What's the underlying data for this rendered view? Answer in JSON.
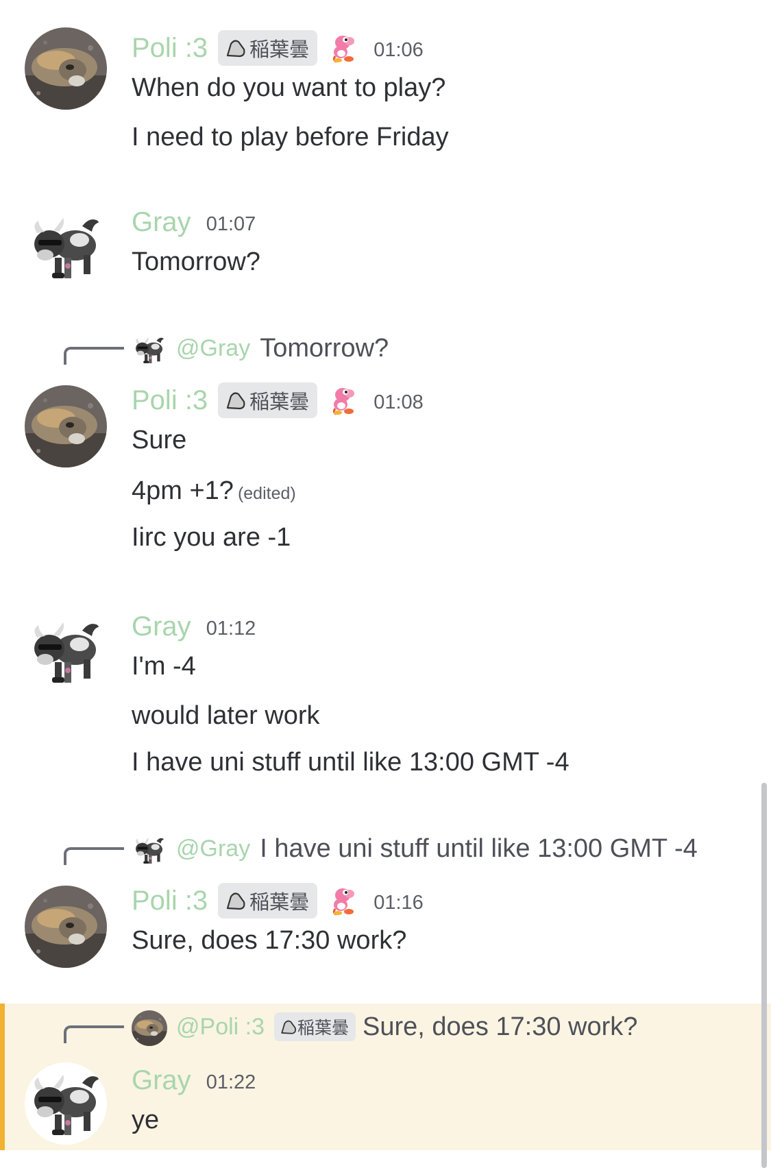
{
  "colors": {
    "username": "#a8d5ac",
    "text": "#2e3035",
    "timestamp": "#5c5e66",
    "tag_bg": "#e6e7e9",
    "highlight_bg": "#fbf4e2",
    "highlight_bar": "#f0b232",
    "reply_spine": "#6d6f78"
  },
  "messages": [
    {
      "author": "Poli :3",
      "tag": "稲葉曇",
      "tag_icon": "rock-icon",
      "role_icon": "pink-yoshi-icon",
      "time": "01:06",
      "avatar": "toad-avatar",
      "lines": [
        "When do you want to play?",
        "I need to play before Friday"
      ]
    },
    {
      "author": "Gray",
      "time": "01:07",
      "avatar": "tauros-avatar",
      "lines": [
        "Tomorrow?"
      ]
    },
    {
      "reply": {
        "mention": "@Gray",
        "text": "Tomorrow?",
        "avatar": "tauros-avatar"
      },
      "author": "Poli :3",
      "tag": "稲葉曇",
      "tag_icon": "rock-icon",
      "role_icon": "pink-yoshi-icon",
      "time": "01:08",
      "avatar": "toad-avatar",
      "lines": [
        "Sure",
        "4pm +1?",
        "Iirc you are -1"
      ],
      "edited_label": "(edited)"
    },
    {
      "author": "Gray",
      "time": "01:12",
      "avatar": "tauros-avatar",
      "lines": [
        "I'm -4",
        "would later work",
        "I have uni stuff until like 13:00 GMT -4"
      ]
    },
    {
      "reply": {
        "mention": "@Gray",
        "text": "I have uni stuff until like 13:00 GMT -4",
        "avatar": "tauros-avatar"
      },
      "author": "Poli :3",
      "tag": "稲葉曇",
      "tag_icon": "rock-icon",
      "role_icon": "pink-yoshi-icon",
      "time": "01:16",
      "avatar": "toad-avatar",
      "lines": [
        "Sure, does 17:30 work?"
      ]
    },
    {
      "highlighted": true,
      "reply": {
        "mention": "@Poli :3",
        "tag": "稲葉曇",
        "text": "Sure, does 17:30 work?",
        "avatar": "toad-avatar"
      },
      "author": "Gray",
      "time": "01:22",
      "avatar": "tauros-avatar",
      "lines": [
        "ye"
      ]
    }
  ]
}
